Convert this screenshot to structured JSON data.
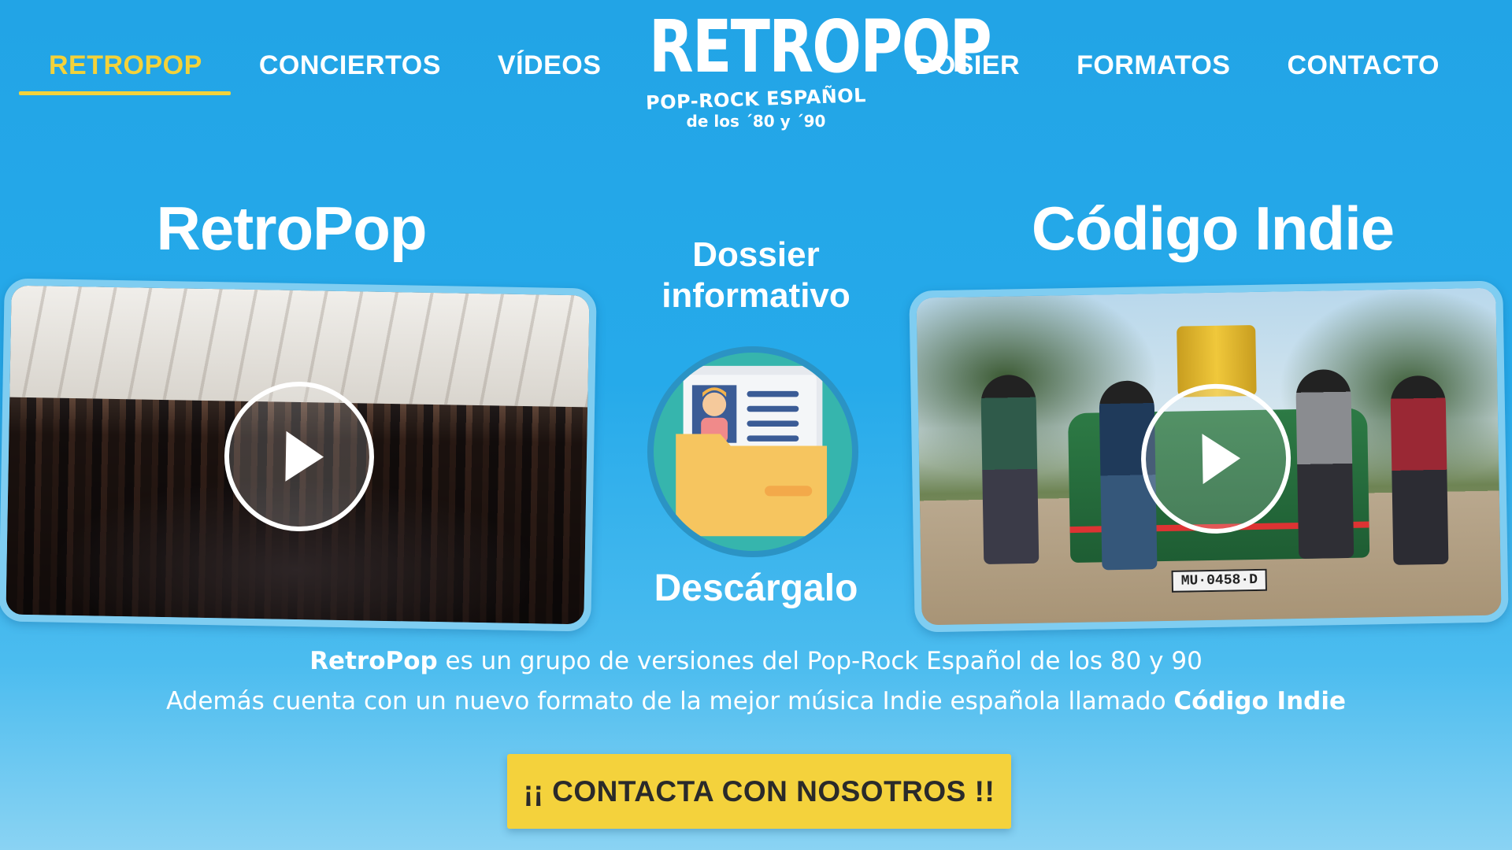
{
  "nav": {
    "left": [
      {
        "label": "RETROPOP",
        "active": true
      },
      {
        "label": "CONCIERTOS",
        "active": false
      },
      {
        "label": "VÍDEOS",
        "active": false
      }
    ],
    "right": [
      {
        "label": "DOSIER"
      },
      {
        "label": "FORMATOS"
      },
      {
        "label": "CONTACTO"
      }
    ]
  },
  "logo": {
    "main": "RETROPOP",
    "sub": "POP-ROCK ESPAÑOL",
    "sub2": "de los ´80 y ´90"
  },
  "sections": {
    "left_title": "RetroPop",
    "right_title": "Código Indie"
  },
  "right_video": {
    "plate": "MU·0458·D"
  },
  "dossier": {
    "title_line1": "Dossier",
    "title_line2": "informativo",
    "cta": "Descárgalo"
  },
  "description": {
    "line1_bold": "RetroPop",
    "line1_rest": " es un grupo de versiones del Pop-Rock Español de los 80 y 90",
    "line2_rest": "Además cuenta con un nuevo formato de la mejor música Indie española llamado ",
    "line2_bold": "Código Indie"
  },
  "cta_button": {
    "label": "¡¡ CONTACTA CON NOSOTROS !!"
  },
  "colors": {
    "accent_yellow": "#f3d23a",
    "background_blue": "#26aaea",
    "card_border": "#7fcdf1"
  },
  "icons": {
    "video_play": "play-icon",
    "dossier": "folder-document-icon"
  }
}
